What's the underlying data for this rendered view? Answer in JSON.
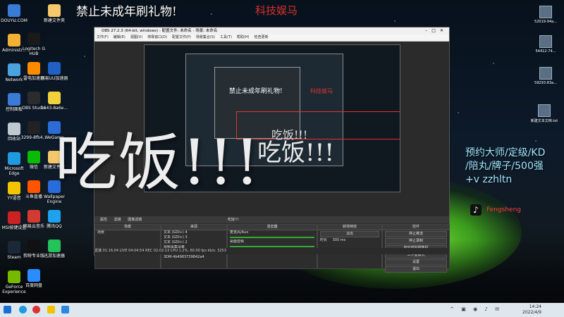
{
  "overlay": {
    "top_text": "禁止未成年刷礼物!",
    "red_text": "科技娱马",
    "big_text": "吃饭!!!",
    "side_ad_lines": [
      "预约大师/定级/KD",
      "/陪丸/牌子/500强",
      "+v zzhltn"
    ],
    "tiktok_name": "Fengsheng"
  },
  "desktop_icons_left": [
    {
      "label": "DOUYU.COM",
      "color": "#3a7bd5"
    },
    {
      "label": "Administr...",
      "color": "#f2b134"
    },
    {
      "label": "Network",
      "color": "#4aa3df"
    },
    {
      "label": "控制面板",
      "color": "#3a7bd5"
    },
    {
      "label": "回收站",
      "color": "#c0c9d0"
    },
    {
      "label": "Microsoft Edge",
      "color": "#1e9be0"
    },
    {
      "label": "YY语音",
      "color": "#f5c400"
    },
    {
      "label": "MSI按键设置",
      "color": "#cc2222"
    },
    {
      "label": "Steam",
      "color": "#1b2838"
    },
    {
      "label": "GeForce Experience",
      "color": "#76b900"
    }
  ],
  "desktop_icons_col2": [
    {
      "label": "Logitech G HUB",
      "color": "#1a1a1a"
    },
    {
      "label": "雷电加速器",
      "color": "#ff8a00"
    },
    {
      "label": "OBS Studio",
      "color": "#2c2c2c"
    },
    {
      "label": "3299-8fb4...",
      "color": "#222"
    },
    {
      "label": "微信",
      "color": "#09bb07"
    },
    {
      "label": "斗鱼直播",
      "color": "#ff5500"
    },
    {
      "label": "网易云音乐",
      "color": "#d33a31"
    },
    {
      "label": "剪映专业版",
      "color": "#111"
    },
    {
      "label": "百度网盘",
      "color": "#2b8cff"
    }
  ],
  "desktop_icons_col3": [
    {
      "label": "新建文件夹",
      "color": "#f5c86b"
    },
    {
      "label": "网易UU加速器",
      "color": "#2160c4"
    },
    {
      "label": "1643-8a6e...",
      "color": "#f2d23c"
    },
    {
      "label": "WeGame",
      "color": "#2b6cd8"
    },
    {
      "label": "新建文件夹",
      "color": "#f5c86b"
    },
    {
      "label": "Wallpaper Engine",
      "color": "#2a6bdc"
    },
    {
      "label": "腾讯QQ",
      "color": "#1fa1f0"
    },
    {
      "label": "迅游加速器",
      "color": "#24c25a"
    }
  ],
  "desktop_icons_right": [
    {
      "label": "52019-94a..."
    },
    {
      "label": "54412-74..."
    },
    {
      "label": "59293-83a..."
    },
    {
      "label": "新建文本文档.txt"
    }
  ],
  "obs": {
    "title": "OBS 27.2.3 (64-bit, windows) - 配置文件: 未命名 - 场景: 未命名",
    "menu": [
      "文件(F)",
      "编辑(E)",
      "视图(V)",
      "停靠窗口(D)",
      "配置文件(P)",
      "场景集合(S)",
      "工具(T)",
      "帮助(H)",
      "检查更新"
    ],
    "toolbar": [
      "属性",
      "滤镜",
      "图像滤镜"
    ],
    "toolbar_text": "吃饭!!!",
    "scenes_header": "场景",
    "scenes": [
      "场景"
    ],
    "sources_header": "来源",
    "sources": [
      "文本 (GDI+) 4",
      "文本 (GDI+) 3",
      "文本 (GDI+) 2",
      "视频采集设备",
      "文本 (GDI+) 5",
      "3DM-4b4983739842a4"
    ],
    "mixer_header": "混音器",
    "mixer": [
      "麦克风/Aux",
      "桌面音频"
    ],
    "transitions_header": "转场特效",
    "transition_value": "淡出",
    "duration_label": "时长",
    "duration_value": "300 ms",
    "controls_header": "控件",
    "controls": [
      "停止推流",
      "停止录制",
      "启动虚拟摄像机",
      "工作室模式",
      "设置",
      "退出"
    ],
    "status": "直播 01:16:04   LIVE 04:04:54   REC 02:02:13   CPU 1.2%, 60.00 fps   kb/s: 3253"
  },
  "taskbar": {
    "time": "14:24",
    "date": "2022/4/9"
  }
}
